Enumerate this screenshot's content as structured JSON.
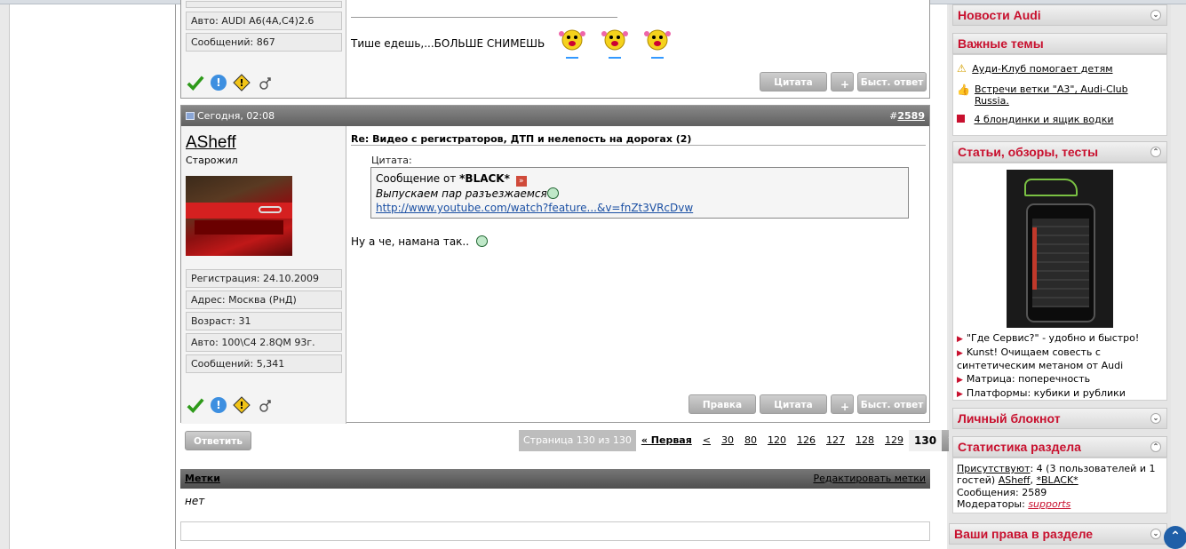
{
  "post1": {
    "auto": "Авто: AUDI A6(4A,C4)2.6",
    "messages": "Сообщений: 867",
    "text": "Тише едешь,...БОЛЬШЕ СНИМЕШЬ",
    "btn_quote": "Цитата",
    "btn_quick": "Быст. ответ"
  },
  "post2": {
    "date": "Сегодня, 02:08",
    "num_prefix": "#",
    "num": "2589",
    "username": "ASheff",
    "rank": "Старожил",
    "registration": "Регистрация: 24.10.2009",
    "address": "Адрес: Москва (РнД)",
    "age": "Возраст: 31",
    "auto": "Авто: 100\\C4 2.8QM 93г.",
    "messages": "Сообщений: 5,341",
    "title": "Re: Видео с регистраторов, ДТП и нелепость на дорогах (2)",
    "quote_label": "Цитата:",
    "quote_from_prefix": "Сообщение от ",
    "quote_author": "*BLACK*",
    "quote_text": "Выпускаем пар разъезжаемся",
    "quote_link": "http://www.youtube.com/watch?feature...&v=fnZt3VRcDvw",
    "text": "Ну а че, намана так..",
    "btn_edit": "Правка",
    "btn_quote": "Цитата",
    "btn_quick": "Быст. ответ"
  },
  "reply_button": "Ответить",
  "pager": {
    "info": "Страница 130 из 130",
    "first": "« Первая",
    "prev": "<",
    "pages": [
      "30",
      "80",
      "120",
      "126",
      "127",
      "128",
      "129"
    ],
    "current": "130"
  },
  "tags": {
    "title": "Метки",
    "edit": "Редактировать метки",
    "value": "нет"
  },
  "sidebar": {
    "news_title": "Новости Audi",
    "important_title": "Важные темы",
    "important_items": [
      "Ауди-Клуб помогает детям",
      "Встречи ветки \"А3\", Audi-Club Russia.",
      "4 блондинки и ящик водки"
    ],
    "articles_title": "Статьи, обзоры, тесты",
    "articles_items": [
      "\"Где Сервис?\" - удобно и быстро!",
      "Kunst! Очищаем совесть с синтетическим метаном от Audi",
      "Матрица: поперечность",
      "Платформы: кубики и рублики"
    ],
    "notebook_title": "Личный блокнот",
    "stats_title": "Статистика раздела",
    "stats_present_label": "Присутствуют",
    "stats_present_rest": ": 4 (3 пользователей и 1 гостей)",
    "stats_user1": "ASheff",
    "stats_user2": "*BLACK*",
    "stats_messages": "Сообщения: 2589",
    "stats_moderators_label": "Модераторы: ",
    "stats_moderators": "supports",
    "rights_title": "Ваши права в разделе"
  },
  "colors": {
    "accent": "#c8102e",
    "header_grey": "#606060",
    "link_blue": "#1a4fa3"
  }
}
